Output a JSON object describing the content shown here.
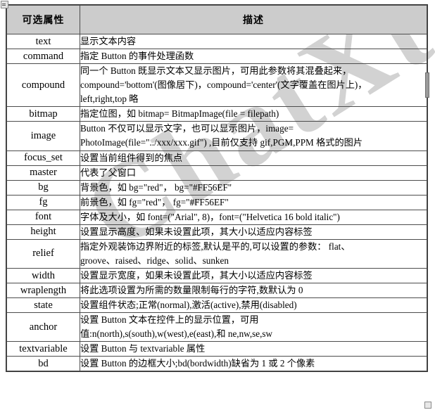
{
  "document": {
    "type": "table",
    "watermark_text": "ChatXt",
    "watermark_color": "#d2d2d2",
    "header_fill": "#cccccc",
    "border_color": "#4c4c4c"
  },
  "table": {
    "headers": {
      "attribute": "可选属性",
      "description": "描述"
    },
    "rows": [
      {
        "attribute": "text",
        "description_lines": [
          "显示文本内容"
        ]
      },
      {
        "attribute": "command",
        "description_lines": [
          "指定 Button 的事件处理函数"
        ]
      },
      {
        "attribute": "compound",
        "description_lines": [
          "同一个 Button 既显示文本又显示图片，可用此参数将其混叠起来，",
          "compound='bottom'(图像居下)，compound='center'(文字覆盖在图片上)，",
          "left,right,top 略"
        ]
      },
      {
        "attribute": "bitmap",
        "description_lines": [
          "指定位图，如 bitmap= BitmapImage(file = filepath)"
        ]
      },
      {
        "attribute": "image",
        "description_lines": [
          "Button 不仅可以显示文字，也可以显示图片，image=",
          "PhotoImage(file=\"../xxx/xxx.gif\") ,目前仅支持 gif,PGM,PPM 格式的图片"
        ]
      },
      {
        "attribute": "focus_set",
        "description_lines": [
          "设置当前组件得到的焦点"
        ]
      },
      {
        "attribute": "master",
        "description_lines": [
          "代表了父窗口"
        ]
      },
      {
        "attribute": "bg",
        "description_lines": [
          "背景色，如 bg=\"red\"，  bg=\"#FF56EF\""
        ]
      },
      {
        "attribute": "fg",
        "description_lines": [
          "前景色，如 fg=\"red\"，  fg=\"#FF56EF\""
        ]
      },
      {
        "attribute": "font",
        "description_lines": [
          "字体及大小，如 font=(\"Arial\", 8)，font=(\"Helvetica 16 bold italic\")"
        ]
      },
      {
        "attribute": "height",
        "description_lines": [
          "设置显示高度、如果未设置此项，其大小以适应内容标签"
        ]
      },
      {
        "attribute": "relief",
        "description_lines": [
          "指定外观装饰边界附近的标签,默认是平的,可以设置的参数：  flat、",
          "groove、raised、ridge、solid、sunken"
        ]
      },
      {
        "attribute": "width",
        "description_lines": [
          "设置显示宽度，如果未设置此项，其大小以适应内容标签"
        ]
      },
      {
        "attribute": "wraplength",
        "description_lines": [
          "将此选项设置为所需的数量限制每行的字符,数默认为 0"
        ]
      },
      {
        "attribute": "state",
        "description_lines": [
          "设置组件状态;正常(normal),激活(active),禁用(disabled)"
        ]
      },
      {
        "attribute": "anchor",
        "description_lines": [
          "设置 Button 文本在控件上的显示位置，可用",
          "值:n(north),s(south),w(west),e(east),和 ne,nw,se,sw"
        ]
      },
      {
        "attribute": "textvariable",
        "description_lines": [
          "设置 Button 与 textvariable 属性"
        ]
      },
      {
        "attribute": "bd",
        "description_lines": [
          "设置 Button 的边框大小;bd(bordwidth)缺省为 1 或 2 个像素"
        ]
      }
    ]
  }
}
